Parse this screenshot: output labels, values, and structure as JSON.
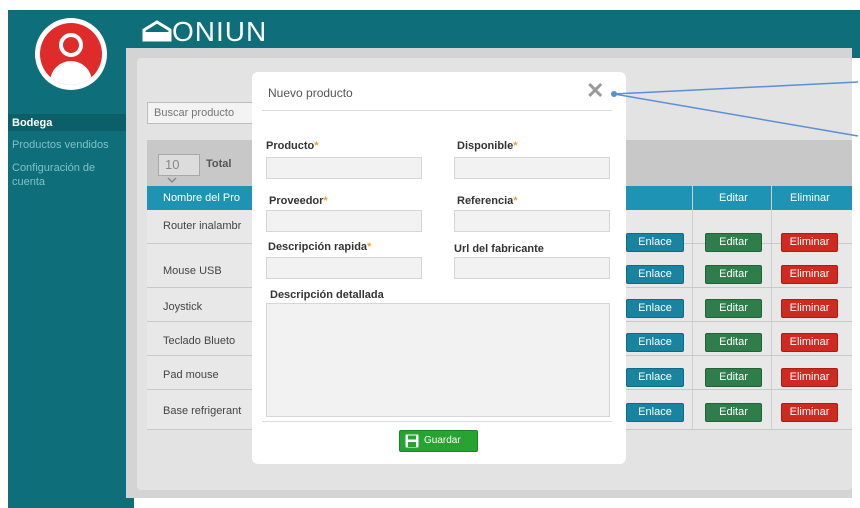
{
  "app": {
    "logo_text": "ONIUN"
  },
  "sidebar": {
    "items": [
      {
        "label": "Bodega"
      },
      {
        "label": "Productos vendidos"
      },
      {
        "label": "Configuración de cuenta"
      }
    ]
  },
  "main": {
    "search_placeholder": "Buscar producto",
    "page_size": "10",
    "total_label": "Total",
    "columns": [
      "Nombre del Pro",
      "Editar",
      "Eliminar"
    ],
    "rows": [
      {
        "name": "Router inalambr"
      },
      {
        "name": "Mouse USB"
      },
      {
        "name": "Joystick"
      },
      {
        "name": "Teclado Blueto"
      },
      {
        "name": "Pad mouse"
      },
      {
        "name": "Base refrigerant"
      }
    ],
    "link_label": "Enlace",
    "edit_label": "Editar",
    "delete_label": "Eliminar"
  },
  "modal": {
    "title": "Nuevo producto",
    "close_glyph": "✕",
    "required_mark": "*",
    "fields": {
      "producto": "Producto",
      "disponible": "Disponible",
      "proveedor": "Proveedor",
      "referencia": "Referencia",
      "descripcion_rapida": "Descripción rapida",
      "url_fabricante": "Url del fabricante",
      "descripcion_detallada": "Descripción detallada"
    },
    "save_label": "Guardar"
  },
  "colors": {
    "sidebar": "#0e6f7a",
    "table_header": "#1f93b4",
    "link_button": "#1884a0",
    "edit_button": "#2e7d4a",
    "delete_button": "#cf2a22",
    "save_button": "#27a332",
    "required_mark": "#f0a030"
  },
  "icons": [
    "user-avatar-icon",
    "house-logo-icon",
    "close-icon",
    "chevron-down-icon",
    "floppy-disk-icon"
  ]
}
